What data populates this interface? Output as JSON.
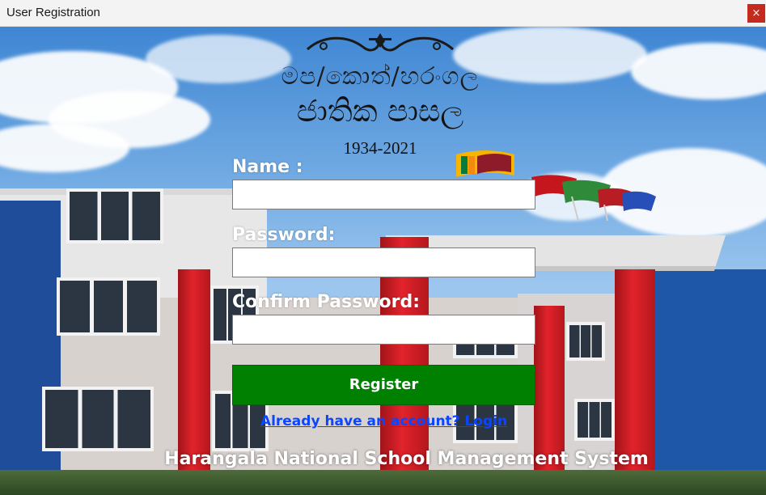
{
  "window": {
    "title": "User Registration",
    "close_glyph": "×"
  },
  "banner": {
    "motto_line1": "මප/කොත්/හරංගල",
    "motto_line2": "ජාතික පාසල",
    "years": "1934-2021"
  },
  "form": {
    "name_label": "Name :",
    "name_value": "",
    "password_label": "Password:",
    "password_value": "",
    "confirm_label": "Confirm Password:",
    "confirm_value": "",
    "register_label": "Register",
    "login_link": "Already have an account? Login"
  },
  "footer": {
    "title": "Harangala National School Management System"
  },
  "colors": {
    "register_button": "#008000",
    "link": "#0a46ff",
    "close_button": "#c42b1c"
  }
}
